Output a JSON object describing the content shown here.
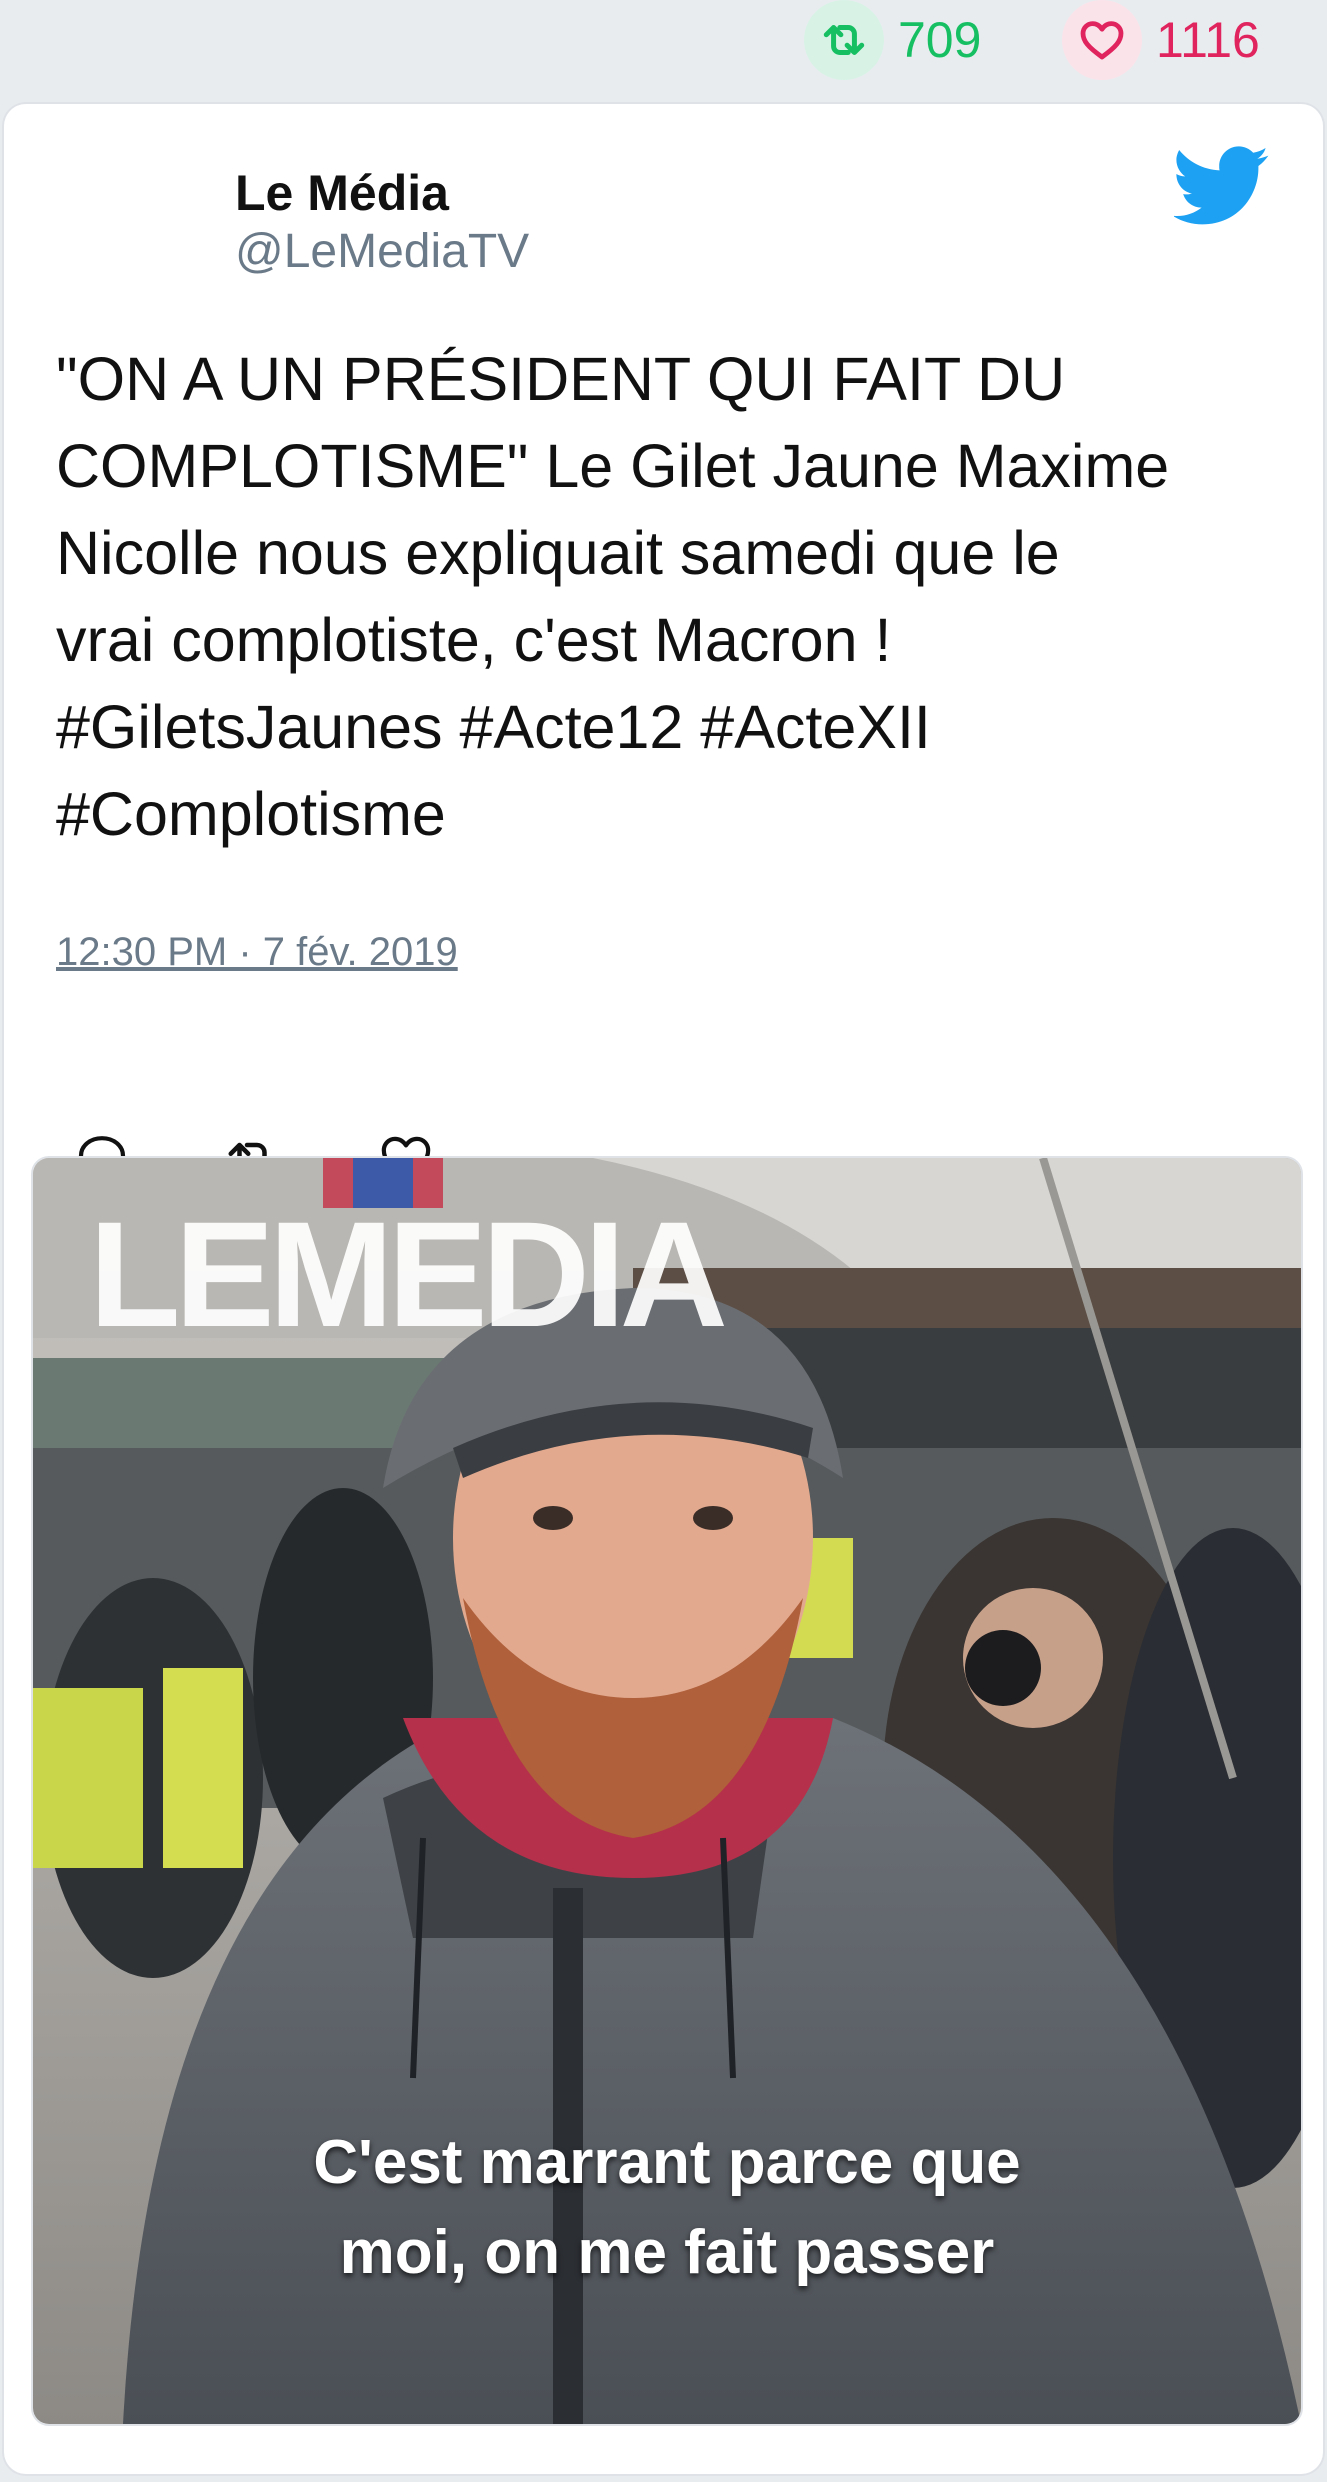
{
  "stats": {
    "retweets": "709",
    "likes": "1116"
  },
  "author": {
    "name": "Le Média",
    "handle": "@LeMediaTV"
  },
  "tweet": {
    "text": "\"ON A UN PRÉSIDENT QUI FAIT DU\nCOMPLOTISME\" Le Gilet Jaune Maxime\nNicolle nous expliquait samedi que le\nvrai complotiste, c'est Macron !\n#GiletsJaunes #Acte12 #ActeXII\n#Complotisme",
    "timestamp": "12:30 PM · 7 fév. 2019"
  },
  "media": {
    "watermark": "LEMEDIA",
    "caption_line1": "C'est marrant parce que",
    "caption_line2": "moi, on me fait passer"
  },
  "icons": {
    "retweet": "retweet-icon",
    "like": "heart-icon",
    "reply": "reply-icon",
    "brand": "twitter-bird-icon"
  },
  "colors": {
    "retweet": "#17bf63",
    "like": "#e0245e",
    "twitter_blue": "#1da1f2",
    "secondary_text": "#6b7a88"
  }
}
